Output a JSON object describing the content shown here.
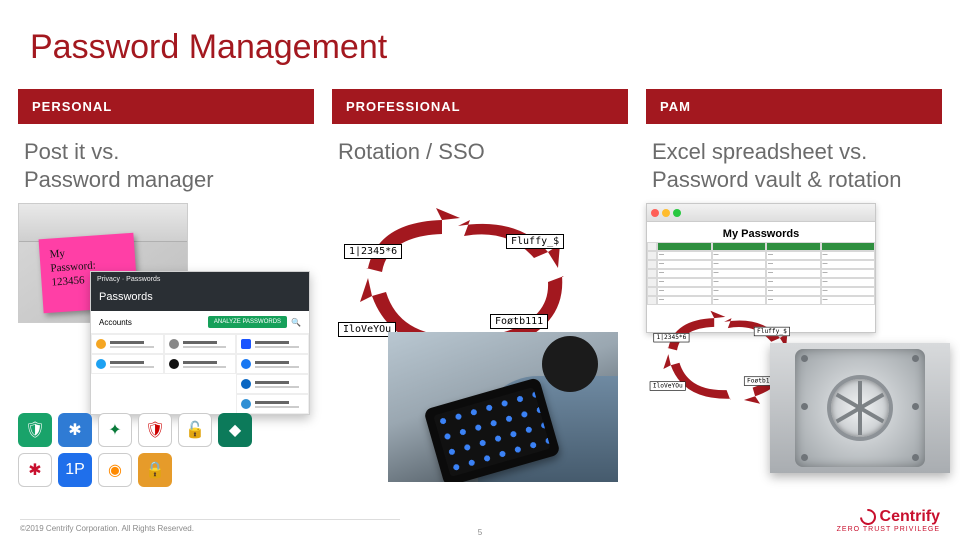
{
  "title": "Password Management",
  "columns": [
    {
      "header": "PERSONAL",
      "sub": "Post it vs.\nPassword manager"
    },
    {
      "header": "PROFESSIONAL",
      "sub": "Rotation / SSO"
    },
    {
      "header": "PAM",
      "sub": "Excel spreadsheet vs.\nPassword vault & rotation"
    }
  ],
  "postit": {
    "line1": "My",
    "line2": "Password:",
    "line3": "123456"
  },
  "password_manager": {
    "breadcrumb": "Privacy  ·  Passwords",
    "title": "Passwords",
    "section": "Accounts",
    "button": "ANALYZE PASSWORDS",
    "search_icon": "search-icon"
  },
  "rotation_labels": [
    "1|2345*6",
    "Fluffy_$",
    "IloVeYOu",
    "Foøtb111"
  ],
  "spreadsheet_title": "My Passwords",
  "footer": {
    "copyright": "©2019 Centrify Corporation. All Rights Reserved.",
    "page": "5",
    "brand": "Centrify",
    "tagline": "ZERO TRUST PRIVILEGE"
  }
}
